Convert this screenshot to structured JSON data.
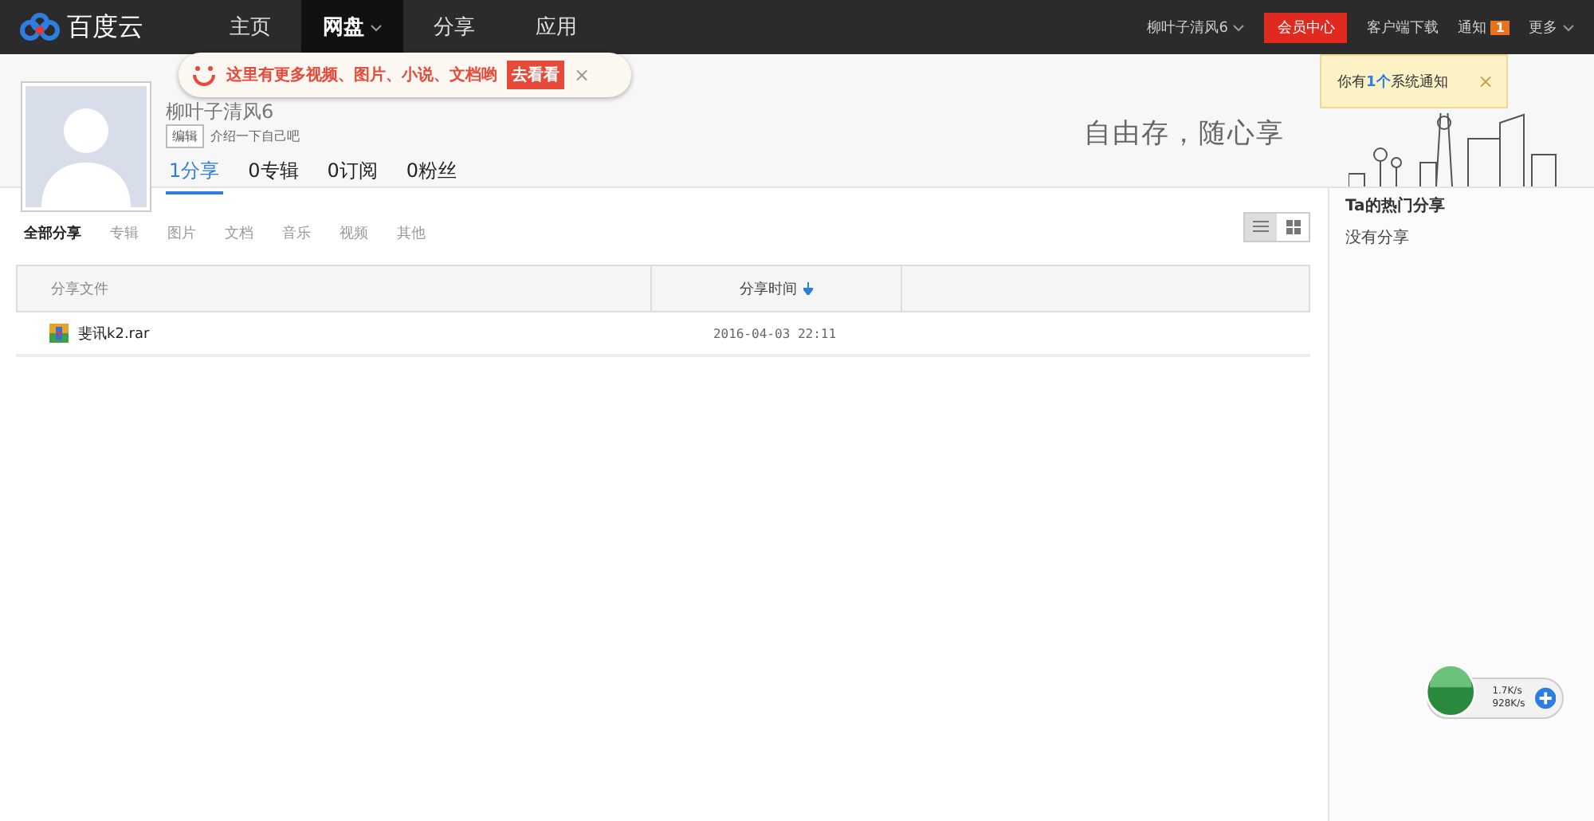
{
  "topbar": {
    "logo": "百度云",
    "nav": [
      {
        "label": "主页",
        "selected": false,
        "caret": false
      },
      {
        "label": "网盘",
        "selected": true,
        "caret": true
      },
      {
        "label": "分享",
        "selected": false,
        "caret": false
      },
      {
        "label": "应用",
        "selected": false,
        "caret": false
      }
    ],
    "user": "柳叶子清风6",
    "vip": "会员中心",
    "download": "客户端下载",
    "notice": "通知",
    "notice_count": "1",
    "more": "更多"
  },
  "tip": {
    "text": "这里有更多视频、图片、小说、文档哟",
    "button": "去看看",
    "close": "×"
  },
  "notice_popup": {
    "text": "你有**1个**系统通知",
    "close": "×"
  },
  "profile": {
    "name": "柳叶子清风6",
    "edit": "编辑",
    "intro": "介绍一下自己吧",
    "stats": [
      {
        "label": "1分享",
        "selected": true
      },
      {
        "label": "0专辑",
        "selected": false
      },
      {
        "label": "0订阅",
        "selected": false
      },
      {
        "label": "0粉丝",
        "selected": false
      }
    ],
    "slogan": "自由存，随心享"
  },
  "filters": [
    {
      "label": "全部分享",
      "selected": true
    },
    {
      "label": "专辑",
      "selected": false
    },
    {
      "label": "图片",
      "selected": false
    },
    {
      "label": "文档",
      "selected": false
    },
    {
      "label": "音乐",
      "selected": false
    },
    {
      "label": "视频",
      "selected": false
    },
    {
      "label": "其他",
      "selected": false
    }
  ],
  "view": {
    "list_selected": true
  },
  "table": {
    "columns": [
      "分享文件",
      "分享时间"
    ],
    "rows": [
      {
        "name": "斐讯k2.rar",
        "time": "2016-04-03 22:11"
      }
    ]
  },
  "sidebar": {
    "title": "Ta的热门分享",
    "empty": "没有分享"
  },
  "speed_widget": {
    "up": "1.7K/s",
    "down": "928K/s"
  }
}
